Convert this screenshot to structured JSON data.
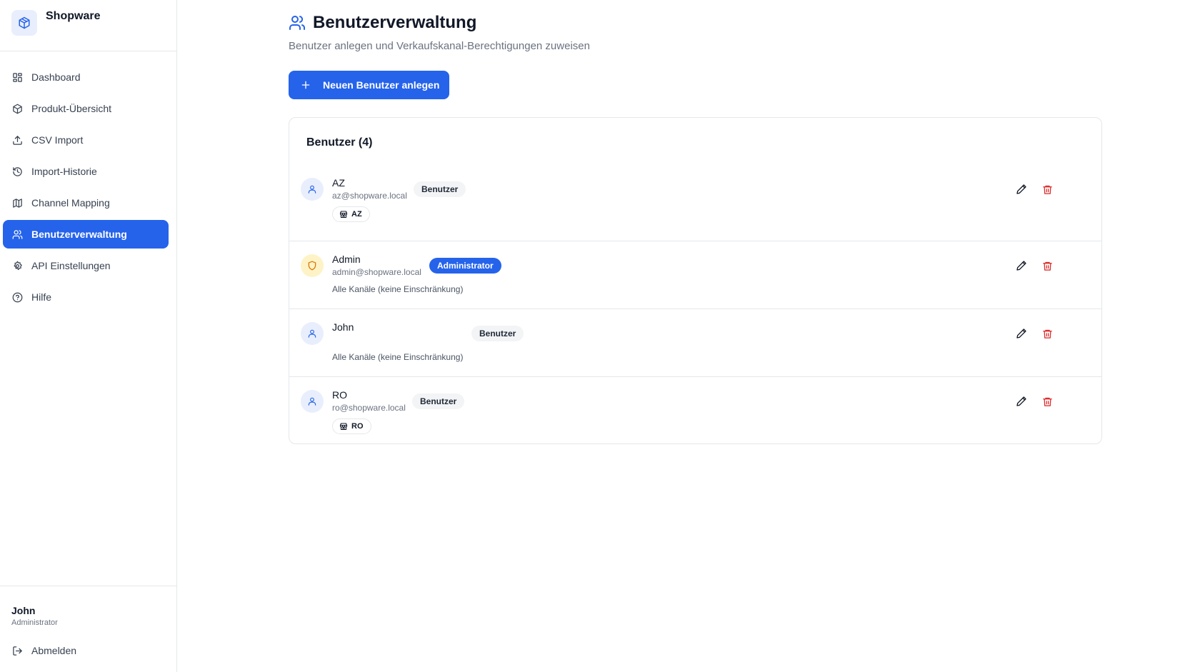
{
  "app": {
    "name": "Shopware",
    "logo_icon": "package-icon"
  },
  "sidebar": {
    "items": [
      {
        "label": "Dashboard",
        "icon": "dashboard-icon",
        "active": false
      },
      {
        "label": "Produkt-Übersicht",
        "icon": "package-icon",
        "active": false
      },
      {
        "label": "CSV Import",
        "icon": "upload-icon",
        "active": false
      },
      {
        "label": "Import-Historie",
        "icon": "history-icon",
        "active": false
      },
      {
        "label": "Channel Mapping",
        "icon": "map-icon",
        "active": false
      },
      {
        "label": "Benutzerverwaltung",
        "icon": "users-icon",
        "active": true
      },
      {
        "label": "API Einstellungen",
        "icon": "gear-icon",
        "active": false
      },
      {
        "label": "Hilfe",
        "icon": "help-icon",
        "active": false
      }
    ],
    "footer": {
      "user_name": "John",
      "user_role": "Administrator",
      "logout_label": "Abmelden"
    }
  },
  "header": {
    "title": "Benutzerverwaltung",
    "subtitle": "Benutzer anlegen und Verkaufskanal-Berechtigungen zuweisen",
    "add_button_label": "Neuen Benutzer anlegen"
  },
  "users_card": {
    "title": "Benutzer (4)",
    "users": [
      {
        "name": "AZ",
        "email": "az@shopware.local",
        "role": "Benutzer",
        "channels": [
          "AZ"
        ],
        "channels_note": ""
      },
      {
        "name": "Admin",
        "email": "admin@shopware.local",
        "role": "Administrator",
        "channels": [],
        "channels_note": "Alle Kanäle (keine Einschränkung)"
      },
      {
        "name": "John",
        "email": "",
        "role": "Benutzer",
        "channels": [],
        "channels_note": "Alle Kanäle (keine Einschränkung)"
      },
      {
        "name": "RO",
        "email": "ro@shopware.local",
        "role": "Benutzer",
        "channels": [
          "RO"
        ],
        "channels_note": ""
      }
    ]
  },
  "colors": {
    "accent": "#2563eb",
    "delete": "#dc2626",
    "admin_avatar": "#fef3c7",
    "admin_icon": "#d97706"
  }
}
